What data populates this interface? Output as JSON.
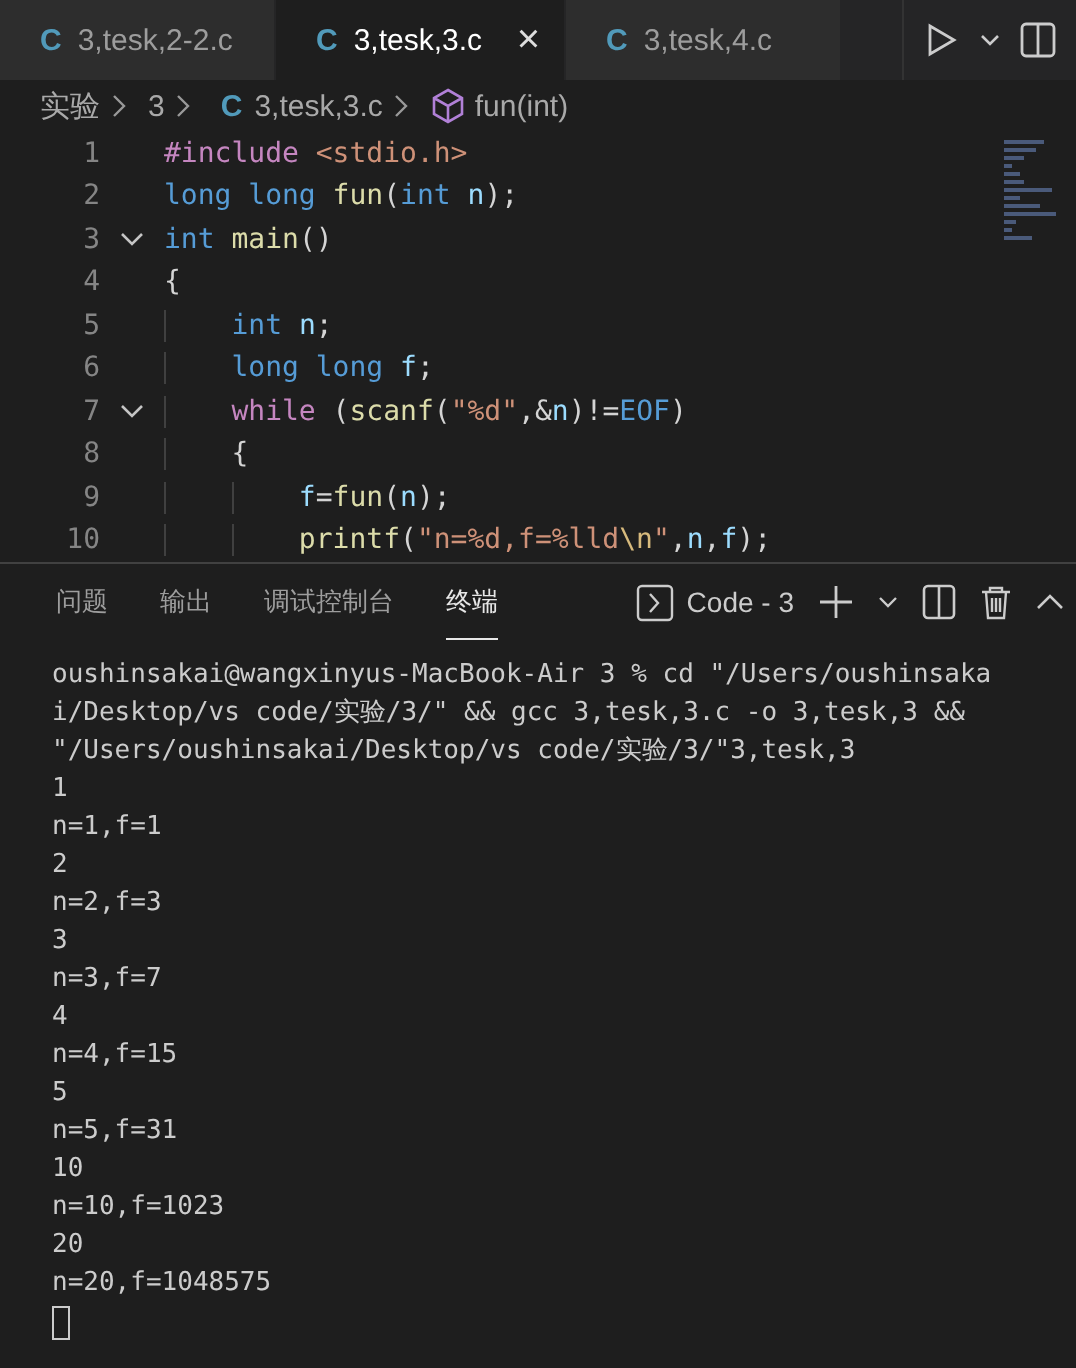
{
  "tabs": [
    {
      "label": "3,tesk,2-2.c",
      "icon": "C",
      "selected": false
    },
    {
      "label": "3,tesk,3.c",
      "icon": "C",
      "selected": true,
      "close": "×"
    },
    {
      "label": "3,tesk,4.c",
      "icon": "C",
      "selected": false
    }
  ],
  "breadcrumb": [
    {
      "kind": "folder",
      "text": "实验"
    },
    {
      "kind": "folder",
      "text": "3"
    },
    {
      "kind": "file",
      "icon": "C",
      "text": "3,tesk,3.c"
    },
    {
      "kind": "symbol",
      "text": "fun(int)"
    }
  ],
  "code_lines": [
    {
      "number": "1",
      "foldable": false,
      "tokens": [
        {
          "kind": "directive",
          "text": "#include "
        },
        {
          "kind": "string",
          "text": "<stdio.h>"
        }
      ]
    },
    {
      "number": "2",
      "foldable": false,
      "tokens": [
        {
          "kind": "keyword",
          "text": "long long "
        },
        {
          "kind": "function",
          "text": "fun"
        },
        {
          "kind": "plain",
          "text": "("
        },
        {
          "kind": "keyword",
          "text": "int "
        },
        {
          "kind": "variable",
          "text": "n"
        },
        {
          "kind": "plain",
          "text": ");"
        }
      ]
    },
    {
      "number": "3",
      "foldable": true,
      "tokens": [
        {
          "kind": "keyword",
          "text": "int "
        },
        {
          "kind": "function",
          "text": "main"
        },
        {
          "kind": "plain",
          "text": "()"
        }
      ]
    },
    {
      "number": "4",
      "foldable": false,
      "tokens": [
        {
          "kind": "plain",
          "text": "{"
        }
      ]
    },
    {
      "number": "5",
      "foldable": false,
      "tokens": [
        {
          "kind": "keyword",
          "text": "    int "
        },
        {
          "kind": "variable",
          "text": "n"
        },
        {
          "kind": "plain",
          "text": ";"
        }
      ]
    },
    {
      "number": "6",
      "foldable": false,
      "tokens": [
        {
          "kind": "keyword",
          "text": "    long long "
        },
        {
          "kind": "variable",
          "text": "f"
        },
        {
          "kind": "plain",
          "text": ";"
        }
      ]
    },
    {
      "number": "7",
      "foldable": true,
      "tokens": [
        {
          "kind": "control",
          "text": "    while "
        },
        {
          "kind": "plain",
          "text": "("
        },
        {
          "kind": "function",
          "text": "scanf"
        },
        {
          "kind": "plain",
          "text": "("
        },
        {
          "kind": "string",
          "text": "\"%d\""
        },
        {
          "kind": "plain",
          "text": ",&"
        },
        {
          "kind": "variable",
          "text": "n"
        },
        {
          "kind": "plain",
          "text": ")!="
        },
        {
          "kind": "keyword",
          "text": "EOF"
        },
        {
          "kind": "plain",
          "text": ")"
        }
      ]
    },
    {
      "number": "8",
      "foldable": false,
      "tokens": [
        {
          "kind": "plain",
          "text": "    {"
        }
      ]
    },
    {
      "number": "9",
      "foldable": false,
      "tokens": [
        {
          "kind": "variable",
          "text": "        f"
        },
        {
          "kind": "plain",
          "text": "="
        },
        {
          "kind": "function",
          "text": "fun"
        },
        {
          "kind": "plain",
          "text": "("
        },
        {
          "kind": "variable",
          "text": "n"
        },
        {
          "kind": "plain",
          "text": ");"
        }
      ]
    },
    {
      "number": "10",
      "foldable": false,
      "tokens": [
        {
          "kind": "function",
          "text": "        printf"
        },
        {
          "kind": "plain",
          "text": "("
        },
        {
          "kind": "string",
          "text": "\"n=%d,f=%lld"
        },
        {
          "kind": "escape",
          "text": "\\n"
        },
        {
          "kind": "string",
          "text": "\""
        },
        {
          "kind": "plain",
          "text": ","
        },
        {
          "kind": "variable",
          "text": "n"
        },
        {
          "kind": "plain",
          "text": ","
        },
        {
          "kind": "variable",
          "text": "f"
        },
        {
          "kind": "plain",
          "text": ");"
        }
      ]
    }
  ],
  "panel_tabs": [
    {
      "label": "问题",
      "selected": false
    },
    {
      "label": "输出",
      "selected": false
    },
    {
      "label": "调试控制台",
      "selected": false
    },
    {
      "label": "终端",
      "selected": true
    }
  ],
  "terminal_name": "Code - 3",
  "terminal_lines": [
    "oushinsakai@wangxinyus-MacBook-Air 3 % cd \"/Users/oushinsakai/Desktop/vs code/实验/3/\" && gcc 3,tesk,3.c -o 3,tesk,3 && \"/Users/oushinsakai/Desktop/vs code/实验/3/\"3,tesk,3",
    "1",
    "n=1,f=1",
    "2",
    "n=2,f=3",
    "3",
    "n=3,f=7",
    "4",
    "n=4,f=15",
    "5",
    "n=5,f=31",
    "10",
    "n=10,f=1023",
    "20",
    "n=20,f=1048575"
  ]
}
